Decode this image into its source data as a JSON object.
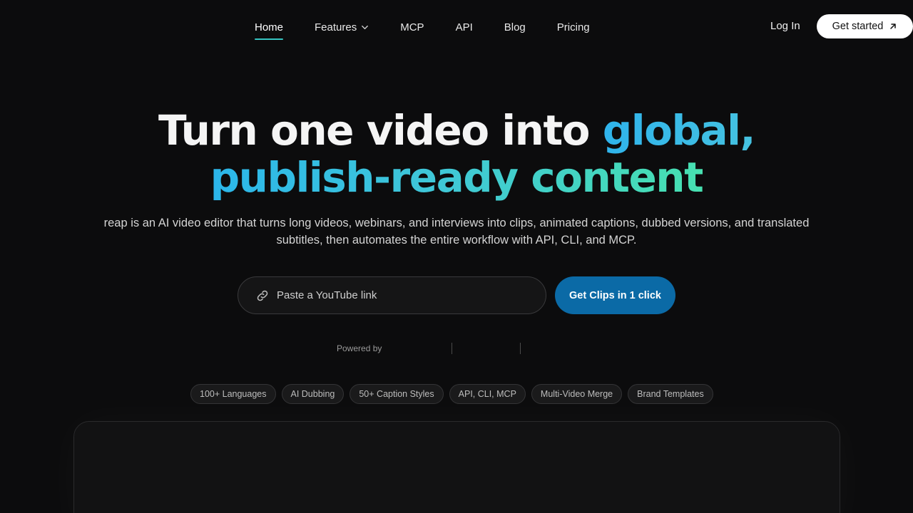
{
  "nav": {
    "items": [
      {
        "label": "Home"
      },
      {
        "label": "Features"
      },
      {
        "label": "MCP"
      },
      {
        "label": "API"
      },
      {
        "label": "Blog"
      },
      {
        "label": "Pricing"
      }
    ],
    "active": "Home",
    "login_label": "Log In",
    "cta_label": "Get started"
  },
  "hero": {
    "title_plain": "Turn one video into ",
    "title_accent_1": "global,",
    "title_accent_2": "publish-ready content",
    "subtitle": "reap is an AI video editor that turns long videos, webinars, and interviews into clips, animated captions, dubbed versions, and translated subtitles, then automates the entire workflow with API, CLI, and MCP."
  },
  "url_form": {
    "placeholder": "Paste a YouTube link",
    "value": "",
    "submit_label": "Get Clips in 1 click"
  },
  "powered_by": {
    "label": "Powered by"
  },
  "chips": [
    "100+ Languages",
    "AI Dubbing",
    "50+ Caption Styles",
    "API, CLI, MCP",
    "Multi-Video Merge",
    "Brand Templates"
  ],
  "colors": {
    "background": "#0c0c0d",
    "accent_gradient_start": "#2bb6ea",
    "accent_gradient_end": "#47e0b0",
    "cta_blue": "#0b6aa6",
    "active_underline": "#35c3c0"
  },
  "icons": {
    "features_dropdown": "chevron-down-icon",
    "cta_arrow": "arrow-up-right-icon",
    "url_field": "link-icon"
  }
}
